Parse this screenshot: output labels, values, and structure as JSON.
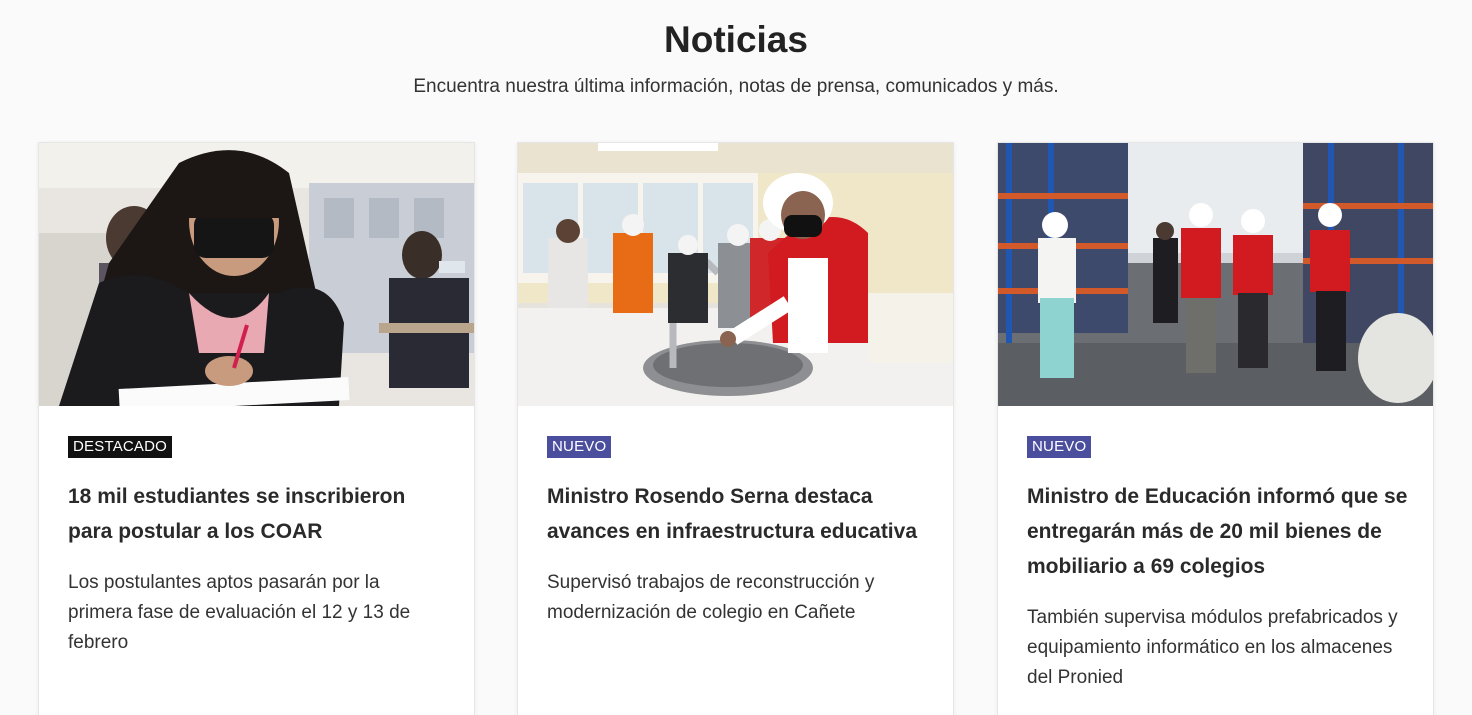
{
  "section": {
    "title": "Noticias",
    "subtitle": "Encuentra nuestra última información, notas de prensa, comunicados y más."
  },
  "cards": [
    {
      "badge": "DESTACADO",
      "title": "18 mil estudiantes se inscribieron para postular a los COAR",
      "description": "Los postulantes aptos pasarán por la primera fase de evaluación el 12 y 13 de febrero",
      "image": "photo-student-writing-exam"
    },
    {
      "badge": "NUEVO",
      "title": "Ministro Rosendo Serna destaca avances en infraestructura educativa",
      "description": "Supervisó trabajos de reconstrucción y modernización de colegio en Cañete",
      "image": "photo-minister-testing-sink"
    },
    {
      "badge": "NUEVO",
      "title": "Ministro de Educación informó que se entregarán más de 20 mil bienes de mobiliario a 69 colegios",
      "description": "También supervisa módulos prefabricados y equipamiento informático en los almacenes del Pronied",
      "image": "photo-officials-in-warehouse"
    }
  ],
  "colors": {
    "badge_featured": "#111111",
    "badge_new": "#4b4e9c",
    "page_background": "#fafafa"
  }
}
